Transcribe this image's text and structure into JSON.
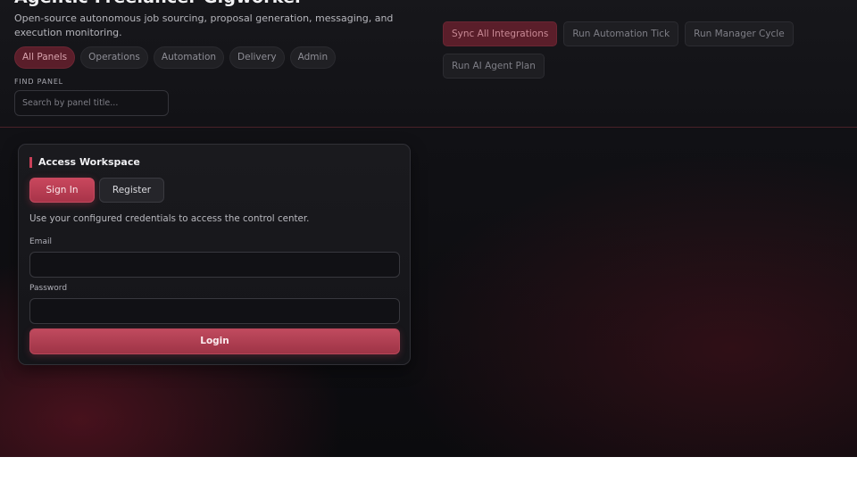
{
  "app": {
    "title": "Agentic Freelancer Gigworker",
    "subtitle": "Open-source autonomous job sourcing, proposal generation, messaging, and execution monitoring."
  },
  "tabs": [
    {
      "label": "All Panels",
      "active": true
    },
    {
      "label": "Operations",
      "active": false
    },
    {
      "label": "Automation",
      "active": false
    },
    {
      "label": "Delivery",
      "active": false
    },
    {
      "label": "Admin",
      "active": false
    }
  ],
  "find_panel": {
    "label": "FIND PANEL",
    "placeholder": "Search by panel title...",
    "value": ""
  },
  "actions": [
    {
      "label": "Sync All Integrations",
      "primary": true
    },
    {
      "label": "Run Automation Tick",
      "primary": false
    },
    {
      "label": "Run Manager Cycle",
      "primary": false
    },
    {
      "label": "Run AI Agent Plan",
      "primary": false
    }
  ],
  "auth": {
    "title": "Access Workspace",
    "signin_label": "Sign In",
    "register_label": "Register",
    "active_mode": "Sign In",
    "description": "Use your configured credentials to access the control center.",
    "email_label": "Email",
    "email_value": "",
    "password_label": "Password",
    "password_value": "",
    "login_label": "Login"
  },
  "colors": {
    "accent": "#c94058",
    "accent_dark": "#5a1e2a",
    "background": "#101014",
    "card": "#18181c"
  }
}
